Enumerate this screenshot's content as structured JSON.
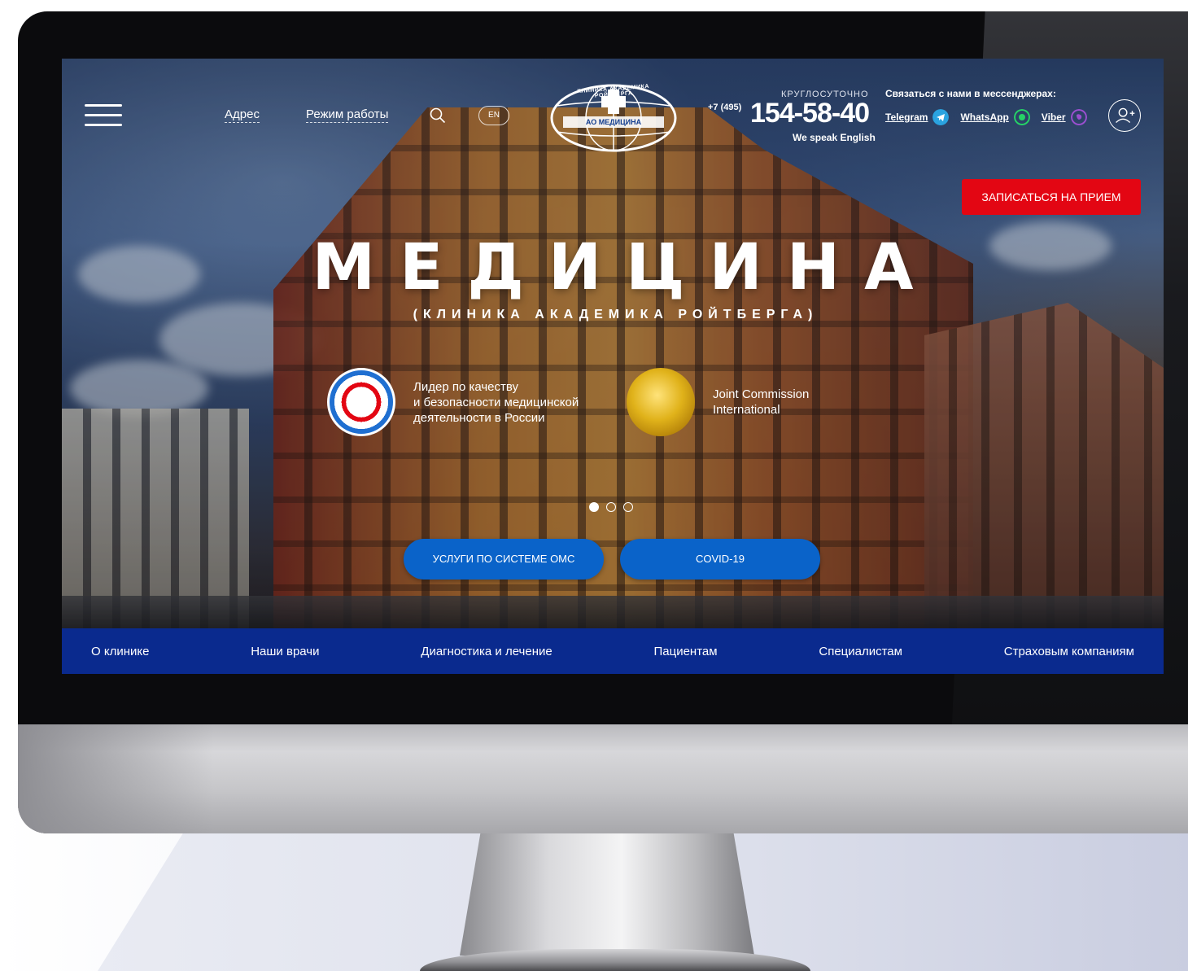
{
  "header": {
    "address_link": "Адрес",
    "hours_link": "Режим работы",
    "lang_button": "EN",
    "logo_text_top": "КЛИНИКА АКАДЕМИКА РОЙТБЕРГА",
    "logo_text_band": "АО МЕДИЦИНА",
    "phone_caption": "КРУГЛОСУТОЧНО",
    "phone_prefix": "+7 (495)",
    "phone_number": "154-58-40",
    "speak_english": "We speak English",
    "messenger_title": "Связаться с нами в мессенджерах:",
    "messengers": [
      {
        "label": "Telegram",
        "icon": "telegram-icon",
        "color": "#2aa3e0"
      },
      {
        "label": "WhatsApp",
        "icon": "whatsapp-icon",
        "color": "#25d366"
      },
      {
        "label": "Viber",
        "icon": "viber-icon",
        "color": "#7d3daf"
      }
    ],
    "book_button": "ЗАПИСАТЬСЯ НА ПРИЕМ"
  },
  "hero": {
    "title": "МЕДИЦИНА",
    "subtitle": "(КЛИНИКА АКАДЕМИКА РОЙТБЕРГА)",
    "badges": [
      {
        "text_lines": [
          "Лидер по качеству",
          "и безопасности медицинской",
          "деятельности в России"
        ],
        "icon": "roszdravnadzor-seal-icon"
      },
      {
        "text_lines": [
          "Joint Commission",
          "International"
        ],
        "icon": "jci-gold-seal-icon"
      }
    ],
    "slides": {
      "count": 3,
      "active": 0
    },
    "cta_buttons": [
      "УСЛУГИ ПО СИСТЕМЕ ОМС",
      "COVID-19"
    ]
  },
  "main_nav": [
    "О клинике",
    "Наши врачи",
    "Диагностика и лечение",
    "Пациентам",
    "Специалистам",
    "Страховым компаниям"
  ],
  "colors": {
    "accent_red": "#e30613",
    "cta_blue": "#0a63c9",
    "nav_blue": "#0a2a8e"
  }
}
